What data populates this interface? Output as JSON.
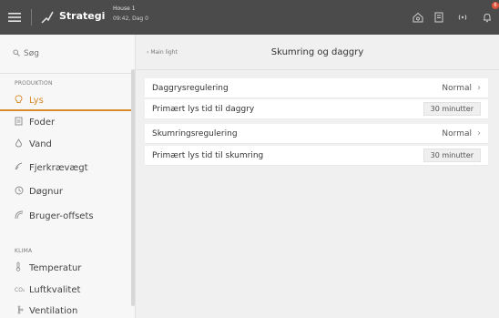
{
  "app": {
    "title": "Strategi",
    "house_name": "House 1",
    "house_time": "09:42, Dag 0",
    "alarm_count": "6"
  },
  "sidebar": {
    "search_placeholder": "Søg",
    "sections": [
      {
        "heading": "PRODUKTION",
        "items": [
          {
            "label": "Lys",
            "icon": "light-icon",
            "active": true
          },
          {
            "label": "Foder",
            "icon": "feed-icon"
          },
          {
            "label": "Vand",
            "icon": "water-icon"
          },
          {
            "label": "Fjerkrævægt",
            "icon": "weight-icon"
          },
          {
            "label": "Døgnur",
            "icon": "clock-icon"
          },
          {
            "label": "Bruger-offsets",
            "icon": "offset-icon"
          }
        ]
      },
      {
        "heading": "KLIMA",
        "items": [
          {
            "label": "Temperatur",
            "icon": "thermometer-icon"
          },
          {
            "label": "Luftkvalitet",
            "icon": "co2-icon"
          },
          {
            "label": "Ventilation",
            "icon": "ventilation-icon"
          }
        ]
      }
    ]
  },
  "main": {
    "back_label": "Main light",
    "title": "Skumring og daggry",
    "rows": [
      {
        "label": "Daggrysregulering",
        "value": "Normal",
        "type": "select"
      },
      {
        "label": "Primært lys tid til daggry",
        "value": "30 minutter",
        "type": "input"
      },
      {
        "label": "Skumringsregulering",
        "value": "Normal",
        "type": "select"
      },
      {
        "label": "Primært lys tid til skumring",
        "value": "30 minutter",
        "type": "input"
      }
    ]
  },
  "colors": {
    "topbar": "#4b4b4b",
    "accent": "#d98a2b",
    "alarm": "#e0533c"
  }
}
